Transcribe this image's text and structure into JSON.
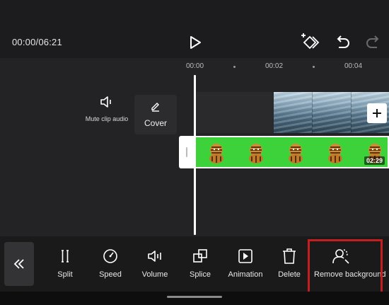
{
  "player": {
    "time": "00:00/06:21"
  },
  "timeline": {
    "ticks": [
      "00:00",
      "00:02",
      "00:04"
    ],
    "mute_label": "Mute clip audio",
    "cover_label": "Cover",
    "clip_duration": "02:29"
  },
  "toolbar": {
    "tools": [
      {
        "label": "Split",
        "icon": "split-icon"
      },
      {
        "label": "Speed",
        "icon": "speed-icon"
      },
      {
        "label": "Volume",
        "icon": "volume-icon"
      },
      {
        "label": "Splice",
        "icon": "splice-icon"
      },
      {
        "label": "Animation",
        "icon": "animation-icon"
      },
      {
        "label": "Delete",
        "icon": "delete-icon"
      },
      {
        "label": "Remove background",
        "icon": "remove-background-icon"
      }
    ]
  },
  "colors": {
    "highlight": "#c41e1e",
    "green_screen": "#3dd13a"
  }
}
